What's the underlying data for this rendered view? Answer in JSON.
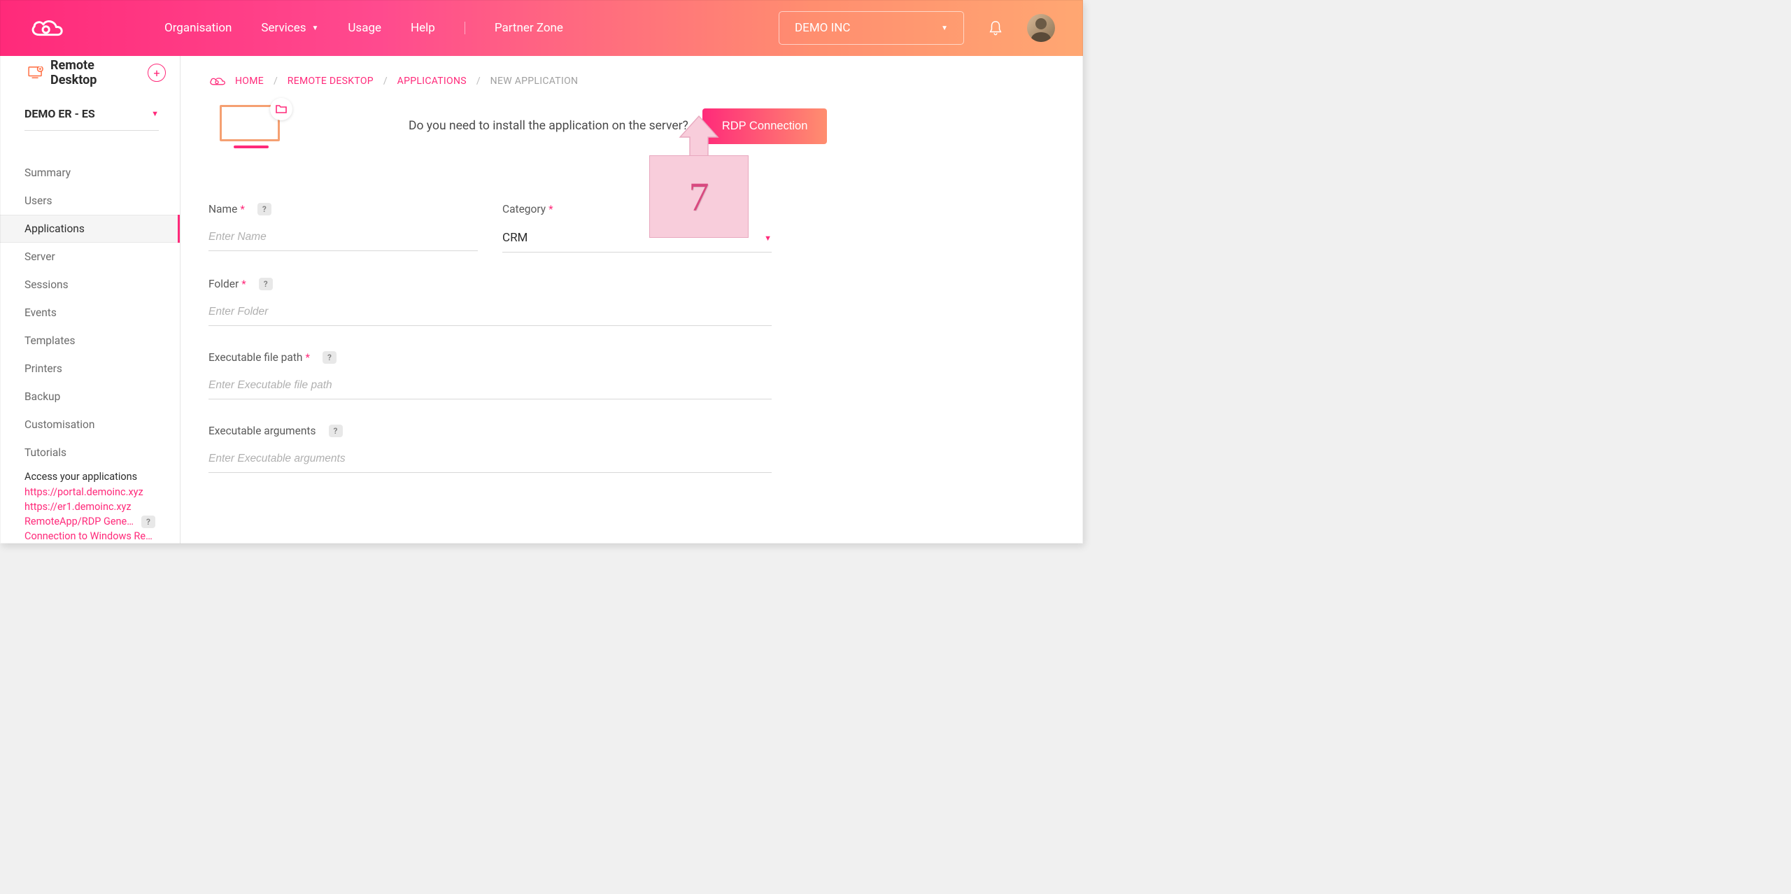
{
  "header": {
    "nav": {
      "organisation": "Organisation",
      "services": "Services",
      "usage": "Usage",
      "help": "Help",
      "partner_zone": "Partner Zone"
    },
    "org_select": "DEMO INC"
  },
  "sidebar": {
    "title": "Remote Desktop",
    "env_select": "DEMO ER - ES",
    "items": [
      "Summary",
      "Users",
      "Applications",
      "Server",
      "Sessions",
      "Events",
      "Templates",
      "Printers",
      "Backup",
      "Customisation",
      "Tutorials"
    ],
    "active_index": 2,
    "footer": {
      "title": "Access your applications",
      "links": [
        "https://portal.demoinc.xyz",
        "https://er1.demoinc.xyz",
        "RemoteApp/RDP Generator",
        "Connection to Windows Rem…"
      ]
    }
  },
  "breadcrumb": {
    "home": "HOME",
    "remote_desktop": "REMOTE DESKTOP",
    "applications": "APPLICATIONS",
    "current": "NEW APPLICATION"
  },
  "hero": {
    "prompt": "Do you need to install the application on the server?",
    "button": "RDP Connection"
  },
  "annotation": {
    "number": "7"
  },
  "form": {
    "name": {
      "label": "Name",
      "placeholder": "Enter Name"
    },
    "category": {
      "label": "Category",
      "value": "CRM"
    },
    "folder": {
      "label": "Folder",
      "placeholder": "Enter Folder"
    },
    "exec_path": {
      "label": "Executable file path",
      "placeholder": "Enter Executable file path"
    },
    "exec_args": {
      "label": "Executable arguments",
      "placeholder": "Enter Executable arguments"
    }
  },
  "glyphs": {
    "help": "?",
    "caret_down": "▼",
    "slash": "/"
  }
}
